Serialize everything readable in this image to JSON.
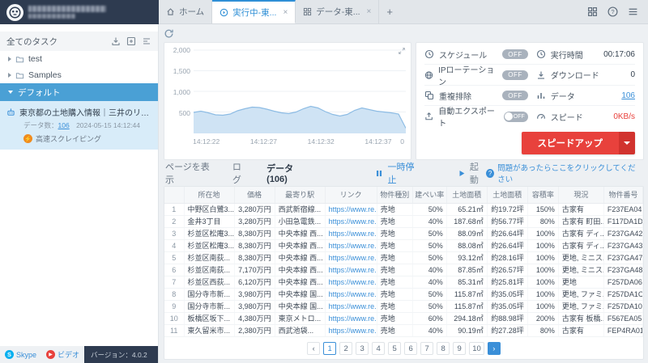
{
  "topbar": {
    "tabs": [
      {
        "label": "ホーム"
      },
      {
        "label": "実行中-東..."
      },
      {
        "label": "データ-東..."
      }
    ]
  },
  "sidebar": {
    "header": "全てのタスク",
    "folders": [
      {
        "label": "test"
      },
      {
        "label": "Samples"
      }
    ],
    "group_label": "デフォルト",
    "task": {
      "title": "東京都の土地購入情報｜三井のリハウス・ス...",
      "count_label": "データ数：",
      "count_value": "106",
      "date": "2024-05-15 14:12:44",
      "mode_label": "高速スクレイピング"
    },
    "footer": {
      "skype_label": "Skype",
      "video_label": "ビデオ",
      "version_label": "バージョン：4.0.2"
    }
  },
  "status": {
    "rows": [
      {
        "left_label": "スケジュール",
        "left_state": "OFF",
        "right_label": "実行時間",
        "right_value": "00:17:06"
      },
      {
        "left_label": "IPローテーション",
        "left_state": "OFF",
        "right_label": "ダウンロード",
        "right_value": "0"
      },
      {
        "left_label": "重複排除",
        "left_state": "OFF",
        "right_label": "データ",
        "right_value": "106"
      },
      {
        "left_label": "自動エクスポート",
        "left_state": "OFF",
        "right_label": "スピード",
        "right_value": "0KB/s"
      }
    ],
    "speedup_label": "スピードアップ"
  },
  "toolbar": {
    "tabs": [
      {
        "label": "ページを表示"
      },
      {
        "label": "ログ"
      },
      {
        "label": "データ(106)"
      }
    ],
    "pause_label": "一時停止",
    "start_label": "起動",
    "help_label": "問題があったらここをクリックしてください"
  },
  "chart_data": {
    "type": "area",
    "ylim": [
      0,
      2000
    ],
    "y_ticks": [
      "2,000",
      "1,500",
      "1,000",
      "500"
    ],
    "x_ticks": [
      "14:12:22",
      "14:12:27",
      "14:12:32",
      "14:12:37"
    ],
    "x_tick_fractions": [
      0.06,
      0.33,
      0.6,
      0.87
    ],
    "right_end_label": "0",
    "grid": true,
    "values": [
      480,
      510,
      470,
      420,
      410,
      440,
      520,
      570,
      610,
      600,
      560,
      510,
      470,
      450,
      490,
      570,
      630,
      590,
      500,
      430,
      390,
      430,
      530,
      590,
      550,
      510,
      490,
      470,
      440,
      90
    ]
  },
  "table": {
    "headers": [
      "",
      "所在地",
      "価格",
      "最寄り駅",
      "リンク",
      "物件種別",
      "建ぺい率",
      "土地面積",
      "土地面積",
      "容積率",
      "現況",
      "物件番号"
    ],
    "rows": [
      [
        "中野区白鷺3...",
        "3,280万円",
        "西武新宿線...",
        "https://www.re...",
        "売地",
        "50%",
        "65.21㎡",
        "約19.72坪",
        "150%",
        "古家有",
        "F237EA04"
      ],
      [
        "金井3丁目",
        "3,280万円",
        "小田急電鉄...",
        "https://www.re...",
        "売地",
        "40%",
        "187.68㎡",
        "約56.77坪",
        "80%",
        "古家有 町田...",
        "F117DA1D"
      ],
      [
        "杉並区松庵3...",
        "8,380万円",
        "中央本線 西...",
        "https://www.re...",
        "売地",
        "50%",
        "88.09㎡",
        "約26.64坪",
        "100%",
        "古家有 ディ...",
        "F237GA42"
      ],
      [
        "杉並区松庵3...",
        "8,380万円",
        "中央本線 西...",
        "https://www.re...",
        "売地",
        "50%",
        "88.08㎡",
        "約26.64坪",
        "100%",
        "古家有 ディ...",
        "F237GA43"
      ],
      [
        "杉並区南荻...",
        "8,380万円",
        "中央本線 西...",
        "https://www.re...",
        "売地",
        "50%",
        "93.12㎡",
        "約28.16坪",
        "100%",
        "更地, ミニス...",
        "F237GA47"
      ],
      [
        "杉並区南荻...",
        "7,170万円",
        "中央本線 西...",
        "https://www.re...",
        "売地",
        "40%",
        "87.85㎡",
        "約26.57坪",
        "100%",
        "更地, ミニス...",
        "F237GA48"
      ],
      [
        "杉並区西荻...",
        "6,120万円",
        "中央本線 西...",
        "https://www.re...",
        "売地",
        "40%",
        "85.31㎡",
        "約25.81坪",
        "100%",
        "更地",
        "F257DA06"
      ],
      [
        "国分寺市新...",
        "3,980万円",
        "中央本線 国...",
        "https://www.re...",
        "売地",
        "50%",
        "115.87㎡",
        "約35.05坪",
        "100%",
        "更地, ファミ...",
        "F257DA1C"
      ],
      [
        "国分寺市新...",
        "3,980万円",
        "中央本線 国...",
        "https://www.re...",
        "売地",
        "50%",
        "115.87㎡",
        "約35.05坪",
        "100%",
        "更地, ファミ...",
        "F257DA10"
      ],
      [
        "板橋区坂下...",
        "4,380万円",
        "東京メトロ...",
        "https://www.re...",
        "売地",
        "60%",
        "294.18㎡",
        "約88.98坪",
        "200%",
        "古家有 板橋...",
        "F567EA05"
      ],
      [
        "東久留米市...",
        "2,380万円",
        "西武池袋...",
        "https://www.re...",
        "売地",
        "40%",
        "90.19㎡",
        "約27.28坪",
        "80%",
        "古家有",
        "FEP4RA01"
      ]
    ]
  },
  "pagination": {
    "pages": [
      "1",
      "2",
      "3",
      "4",
      "5",
      "6",
      "7",
      "8",
      "9",
      "10"
    ],
    "active": "1"
  }
}
